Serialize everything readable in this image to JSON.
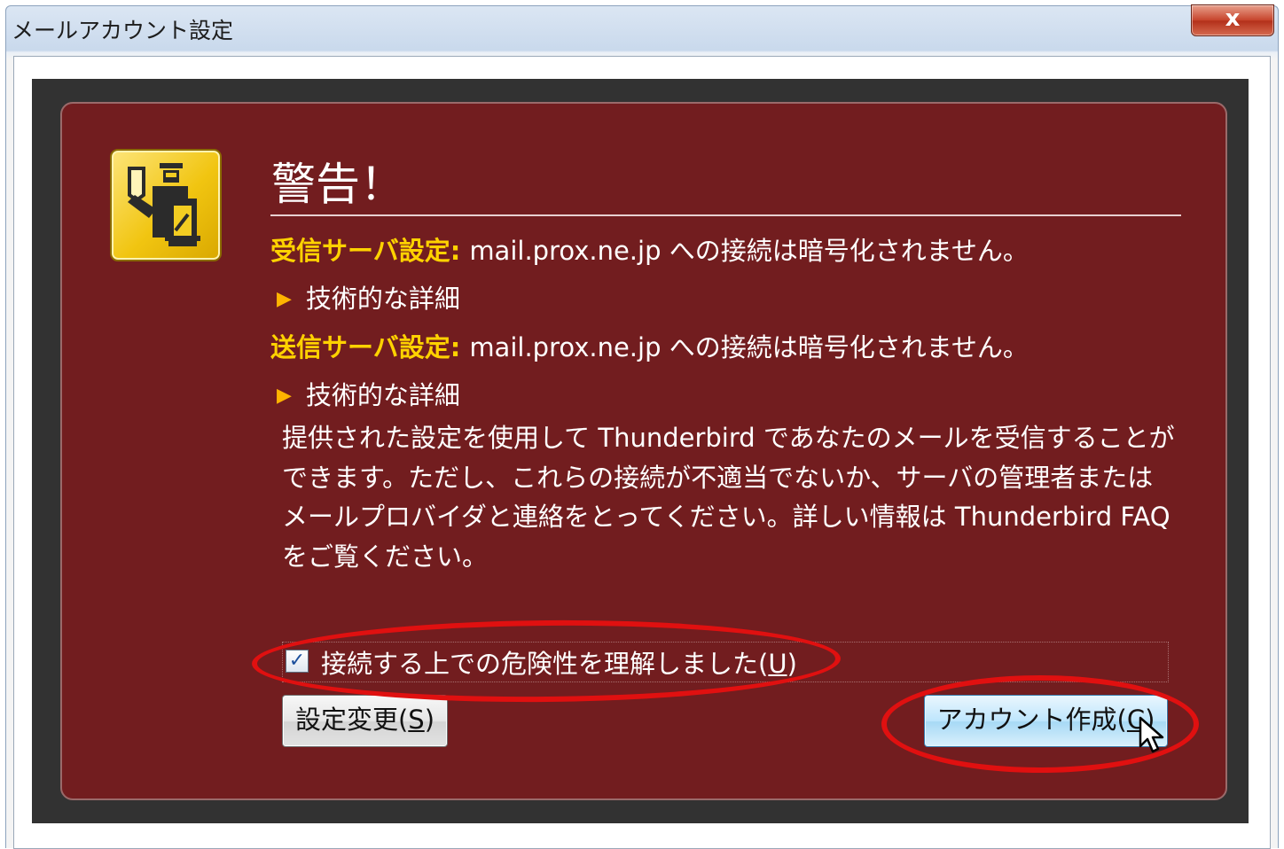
{
  "window": {
    "title": "メールアカウント設定",
    "close_label": "x"
  },
  "warning": {
    "heading": "警告！",
    "incoming": {
      "label": "受信サーバ設定:",
      "message": "mail.prox.ne.jp への接続は暗号化されません。",
      "details_label": "技術的な詳細"
    },
    "outgoing": {
      "label": "送信サーバ設定:",
      "message": "mail.prox.ne.jp への接続は暗号化されません。",
      "details_label": "技術的な詳細"
    },
    "description": "提供された設定を使用して Thunderbird であなたのメールを受信することができます。ただし、これらの接続が不適当でないか、サーバの管理者またはメールプロバイダと連絡をとってください。詳しい情報は Thunderbird FAQ をご覧ください。",
    "acknowledge": {
      "checked": true,
      "label": "接続する上での危険性を理解しました",
      "accesskey_prefix": "(",
      "accesskey": "U",
      "accesskey_suffix": ")"
    }
  },
  "buttons": {
    "change_settings": {
      "label": "設定変更",
      "prefix": "(",
      "accesskey": "S",
      "suffix": ")"
    },
    "create_account": {
      "label": "アカウント作成",
      "prefix": "(",
      "accesskey": "C",
      "suffix": ")"
    }
  },
  "colors": {
    "panel_bg": "#721d1f",
    "label_yellow": "#ffd200",
    "annotation_red": "#e01010"
  },
  "icons": {
    "warning": "officer-warning-icon",
    "check": "checkmark-icon",
    "triangle": "triangle-right-icon",
    "cursor": "mouse-cursor-icon"
  }
}
